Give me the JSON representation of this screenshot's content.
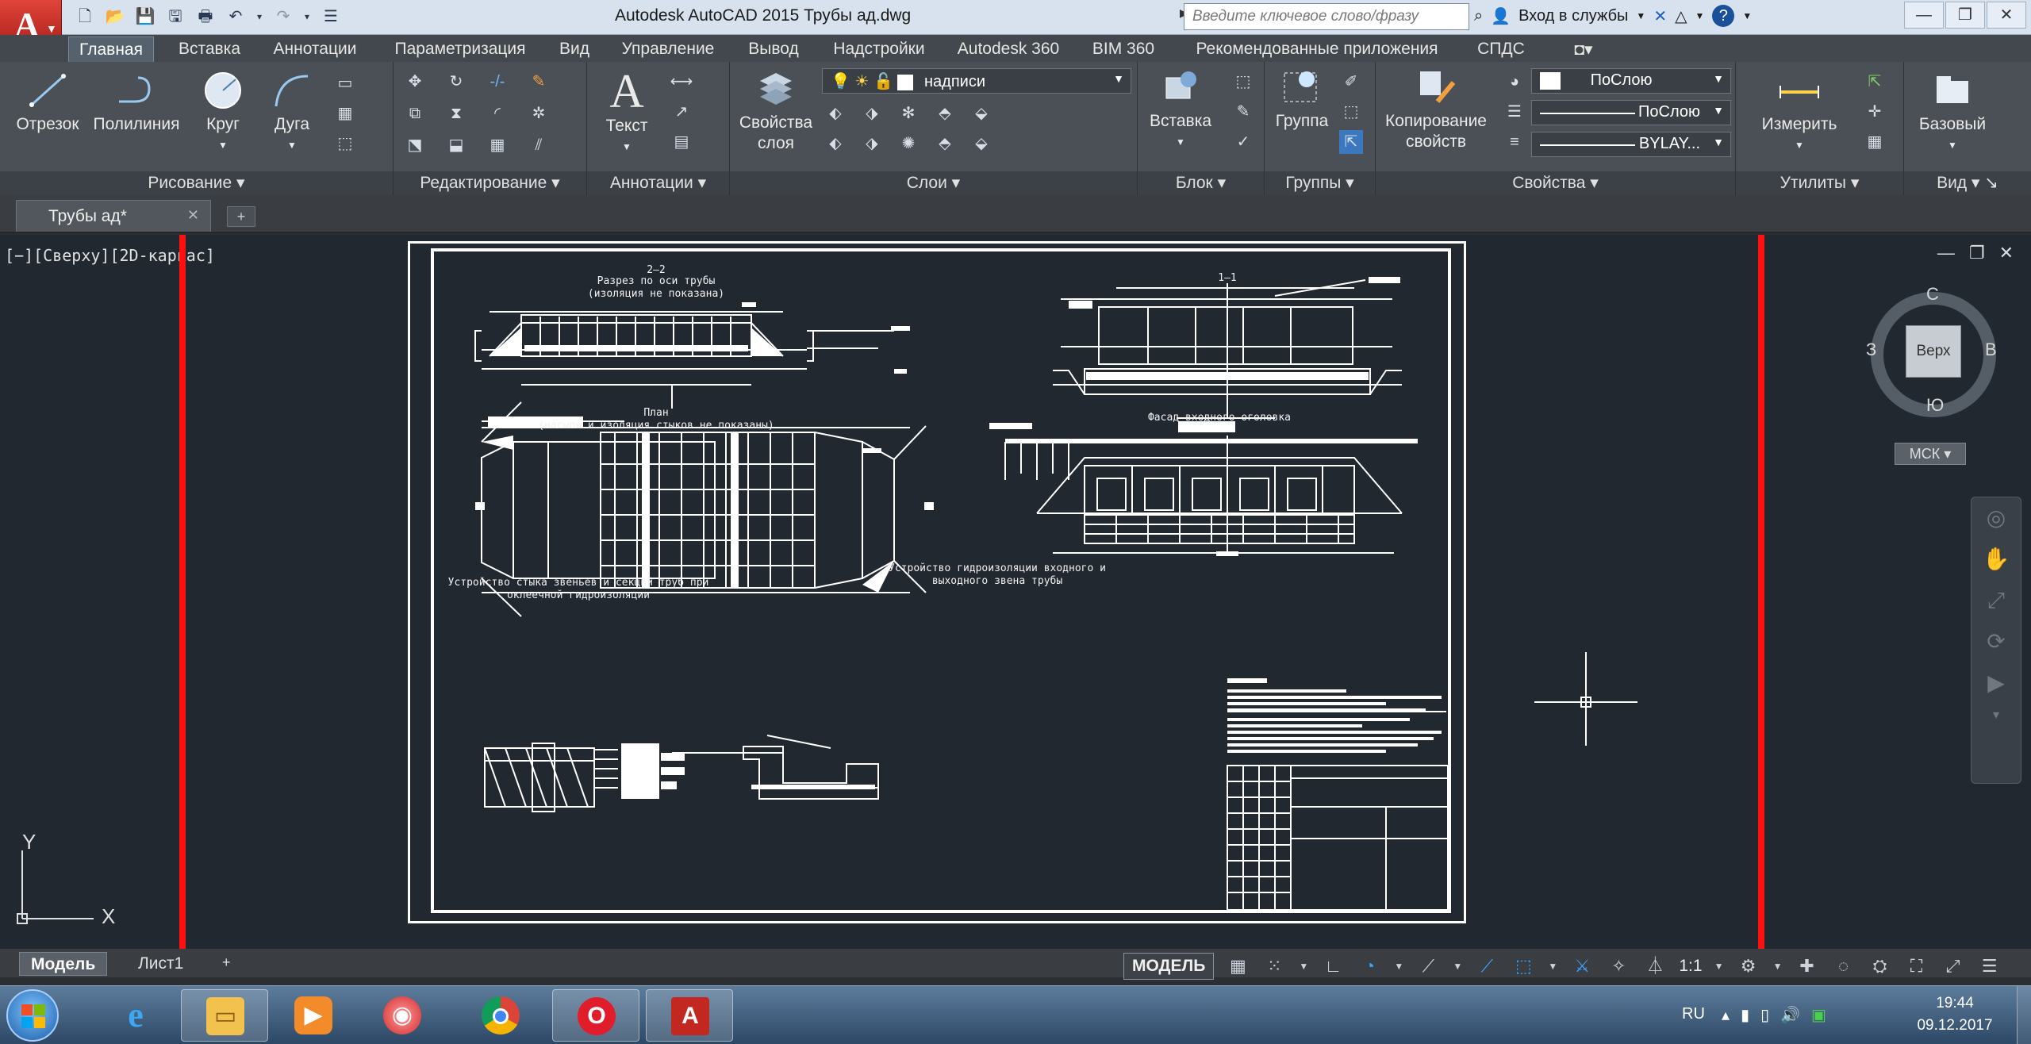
{
  "titlebar": {
    "title": "Autodesk AutoCAD 2015    Трубы ад.dwg",
    "search_placeholder": "Введите ключевое слово/фразу",
    "signin": "Вход в службы"
  },
  "ribbon_tabs": [
    "Главная",
    "Вставка",
    "Аннотации",
    "Параметризация",
    "Вид",
    "Управление",
    "Вывод",
    "Надстройки",
    "Autodesk 360",
    "BIM 360",
    "Рекомендованные приложения",
    "СПДС"
  ],
  "ribbon": {
    "draw": {
      "title": "Рисование",
      "line": "Отрезок",
      "polyline": "Полилиния",
      "circle": "Круг",
      "arc": "Дуга"
    },
    "modify": {
      "title": "Редактирование"
    },
    "annotation": {
      "title": "Аннотации",
      "text": "Текст"
    },
    "layers": {
      "title": "Слои",
      "properties": "Свойства слоя",
      "current_layer": "надписи"
    },
    "block": {
      "title": "Блок",
      "insert": "Вставка"
    },
    "groups": {
      "title": "Группы",
      "group": "Группа"
    },
    "properties": {
      "title": "Свойства",
      "match": "Копирование свойств",
      "color": "ПоСлою",
      "linetype": "ПоСлою",
      "lineweight": "BYLAY..."
    },
    "utilities": {
      "title": "Утилиты",
      "measure": "Измерить"
    },
    "view": {
      "title": "Вид",
      "base": "Базовый"
    }
  },
  "doc_tab": {
    "name": "Трубы ад*"
  },
  "viewport": {
    "label": "[−][Сверху][2D-каркас]",
    "viewcube": {
      "top": "Верх",
      "north": "С",
      "south": "Ю",
      "east": "В",
      "west": "З"
    },
    "ucs_label": "МСК",
    "axis_x": "X",
    "axis_y": "Y"
  },
  "drawing": {
    "section_22": "2–2",
    "section_22_title": "Разрез по оси трубы",
    "section_22_note": "(изоляция не показана)",
    "section_11": "1–1",
    "plan_title": "План",
    "plan_note": "(насыпь и изоляция стыков не показаны)",
    "facade_title": "Фасад входного оголовка",
    "joint_title_1": "Устройство стыка звеньев и секций труб при",
    "joint_title_2": "оклеечной гидроизоляции",
    "waterproof_title_1": "Устройство гидроизоляции входного и",
    "waterproof_title_2": "выходного звена трубы"
  },
  "layout_tabs": [
    "Модель",
    "Лист1"
  ],
  "status": {
    "model": "МОДЕЛЬ",
    "scale": "1:1"
  },
  "taskbar": {
    "lang": "RU",
    "time": "19:44",
    "date": "09.12.2017"
  },
  "colors": {
    "accent_red": "#ff1010",
    "canvas": "#212830",
    "ribbon": "#4b5056"
  }
}
